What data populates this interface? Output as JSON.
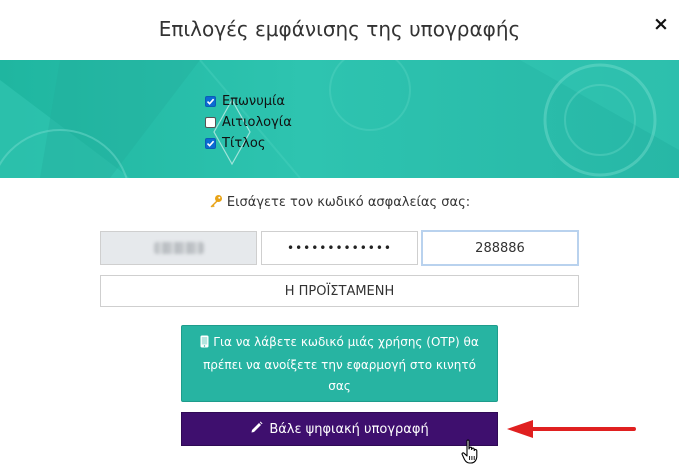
{
  "dialog": {
    "title": "Επιλογές εμφάνισης της υπογραφής",
    "close_label": "×"
  },
  "options": [
    {
      "label": "Επωνυμία",
      "checked": true
    },
    {
      "label": "Αιτιολογία",
      "checked": false
    },
    {
      "label": "Τίτλος",
      "checked": true
    }
  ],
  "prompt": {
    "icon": "key-icon",
    "text": "Εισάγετε τον κωδικό ασφαλείας σας:"
  },
  "fields": {
    "username_blurred": true,
    "password_mask": "•••••••••••••",
    "code_value": "288886",
    "name_value": "Η ΠΡΟΪΣΤΑΜΕΝΗ"
  },
  "otp_button": {
    "icon": "mobile-phone-icon",
    "text": "Για να λάβετε κωδικό μιάς χρήσης (OTP) θα πρέπει να ανοίξετε την εφαρμογή στο κινητό σας",
    "color": "#27b4a2"
  },
  "sign_button": {
    "icon": "pencil-icon",
    "label": "Βάλε ψηφιακή υπογραφή",
    "color": "#3e0f6e"
  },
  "annotation": {
    "arrow_color": "#e02020"
  }
}
